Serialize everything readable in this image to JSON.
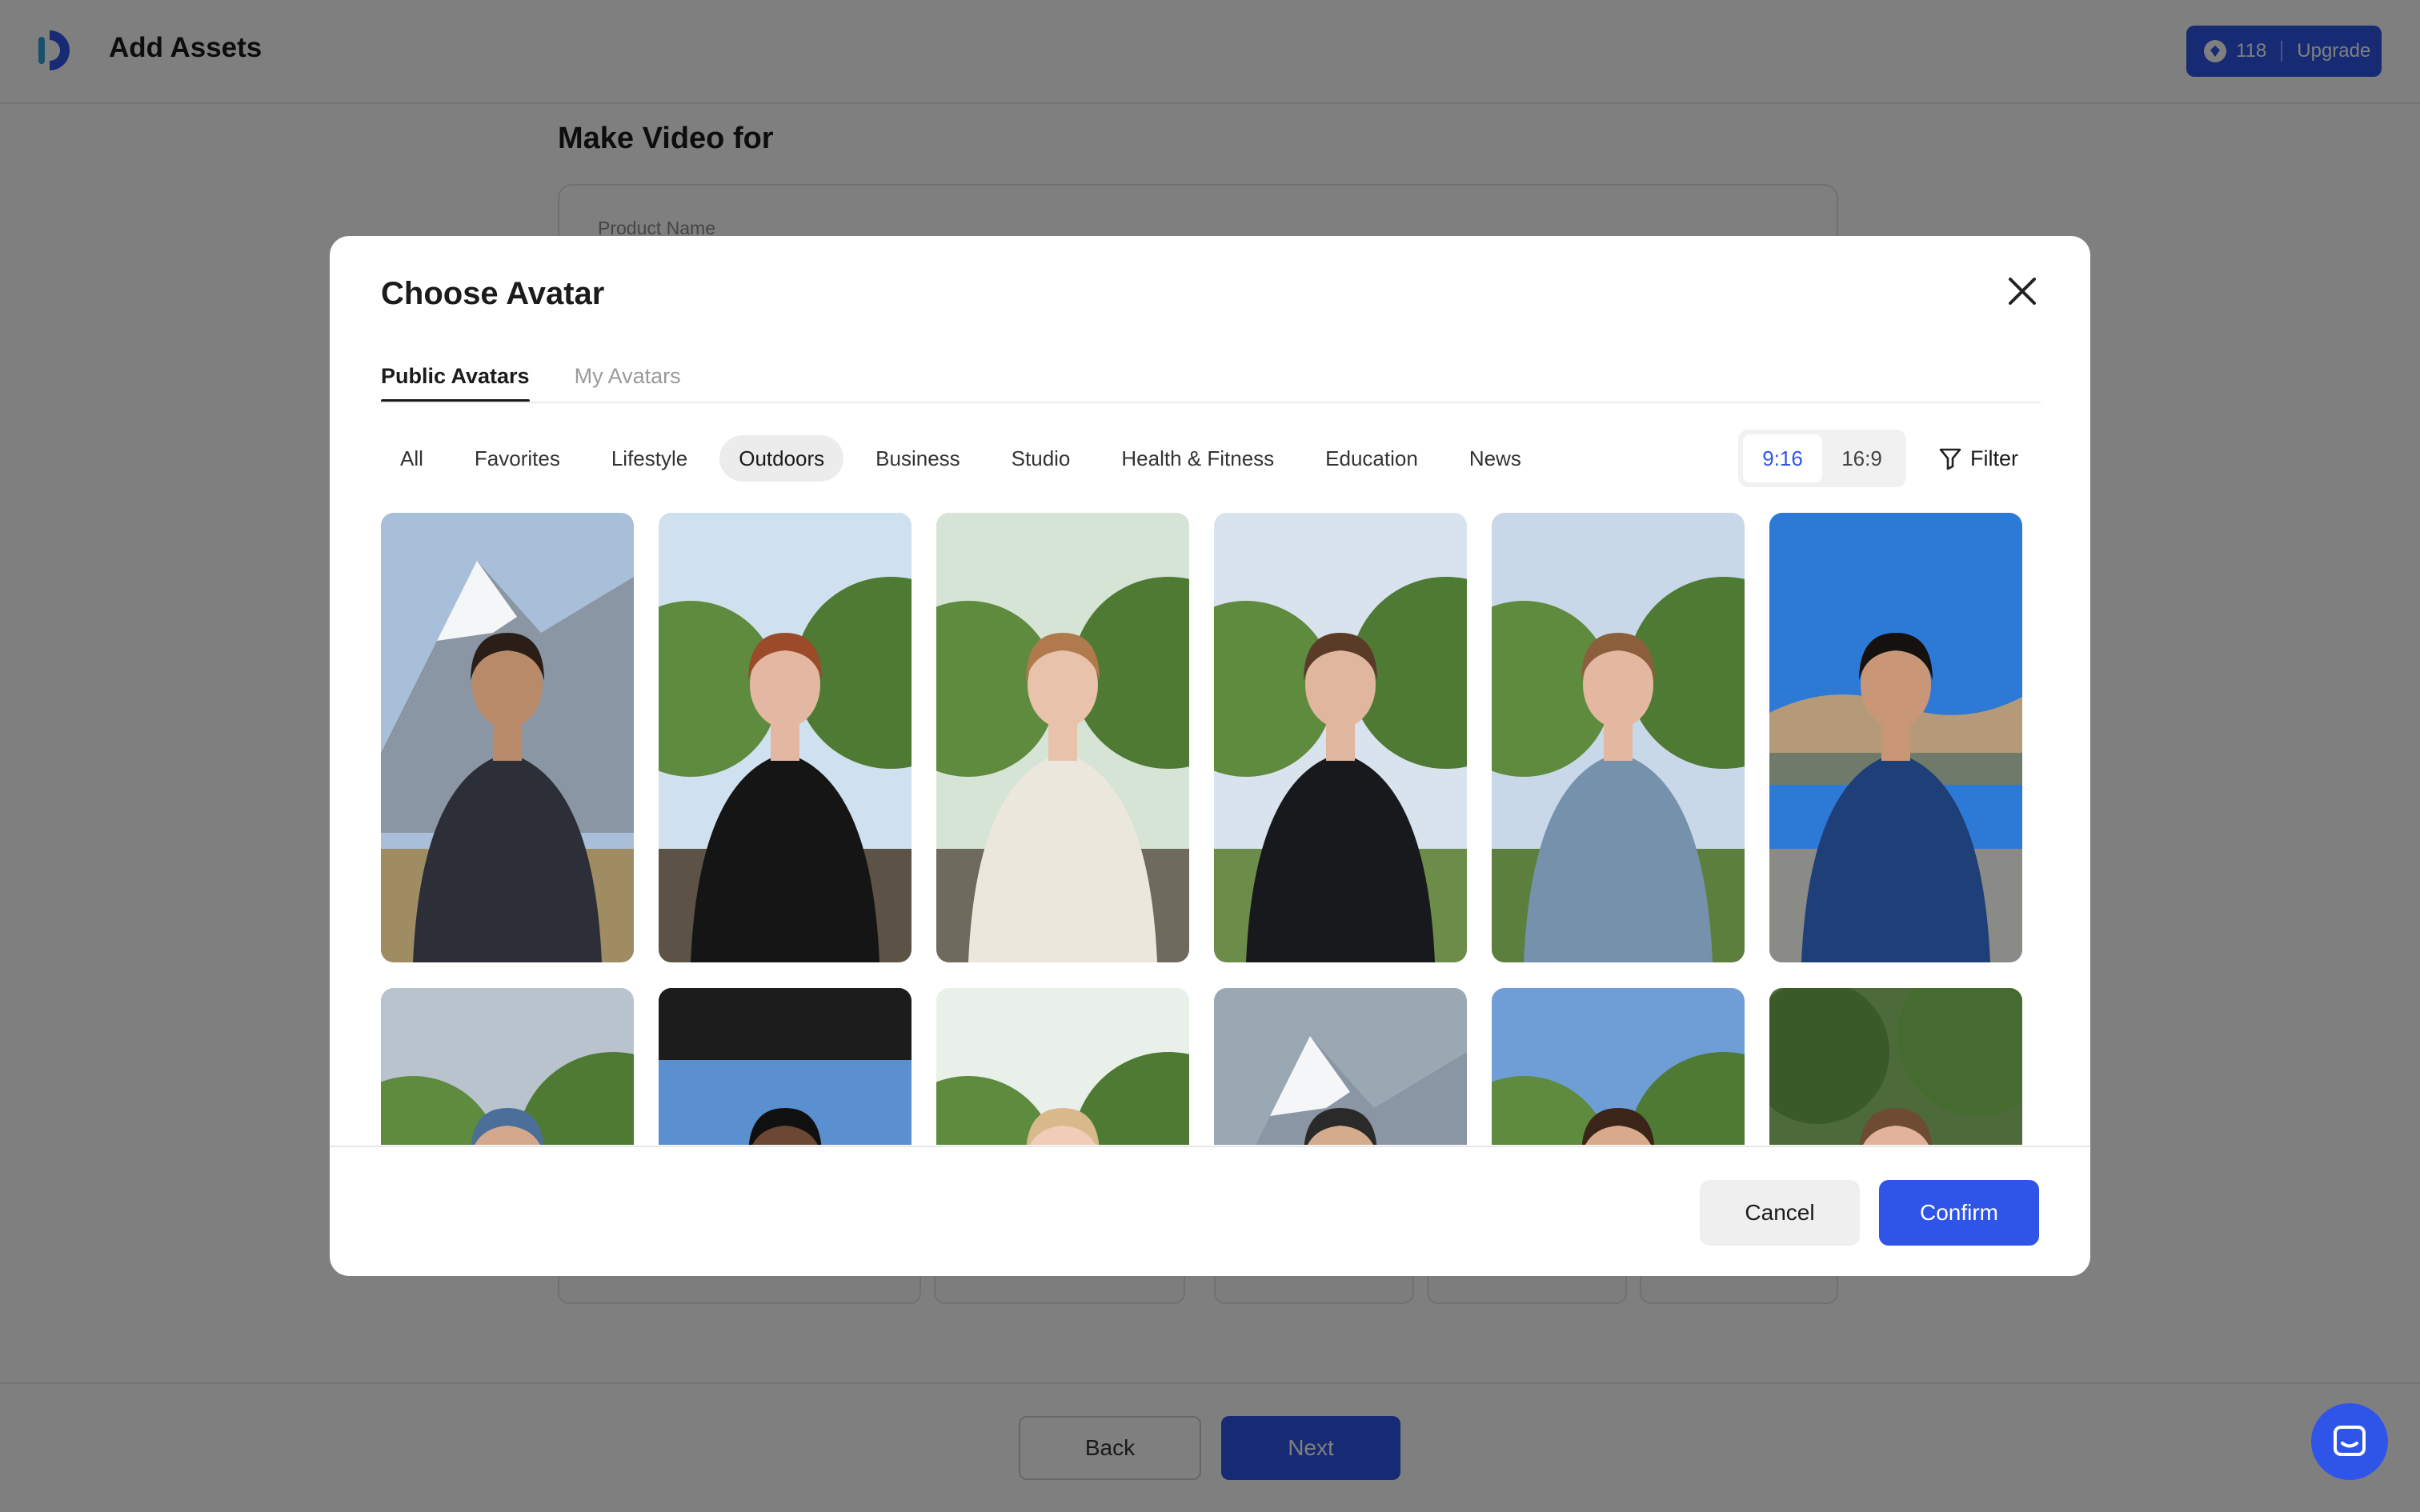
{
  "app": {
    "title": "Add Assets",
    "credits": "118",
    "upgrade_label": "Upgrade"
  },
  "background": {
    "heading": "Make Video for",
    "product_field_label": "Product Name",
    "back_label": "Back",
    "next_label": "Next"
  },
  "modal": {
    "title": "Choose Avatar",
    "tabs": [
      {
        "label": "Public Avatars",
        "active": true
      },
      {
        "label": "My Avatars",
        "active": false
      }
    ],
    "categories": [
      {
        "label": "All"
      },
      {
        "label": "Favorites"
      },
      {
        "label": "Lifestyle"
      },
      {
        "label": "Outdoors",
        "active": true
      },
      {
        "label": "Business"
      },
      {
        "label": "Studio"
      },
      {
        "label": "Health & Fitness"
      },
      {
        "label": "Education"
      },
      {
        "label": "News"
      }
    ],
    "ratio_options": [
      {
        "label": "9:16",
        "active": true
      },
      {
        "label": "16:9",
        "active": false
      }
    ],
    "filter_label": "Filter",
    "cancel_label": "Cancel",
    "confirm_label": "Confirm"
  },
  "avatars": [
    {
      "id": "a1",
      "sky": "#a9bfd9",
      "ground": "#a08c62",
      "top": "#2c2f38",
      "hair": "#2a1e16",
      "skin": "#b98a6a",
      "scene": "mountain"
    },
    {
      "id": "a2",
      "sky": "#cfe1ef",
      "ground": "#5c5246",
      "top": "#151515",
      "hair": "#9b4a2a",
      "skin": "#e3b7a1",
      "scene": "palm"
    },
    {
      "id": "a3",
      "sky": "#d6e4d5",
      "ground": "#6f6a5e",
      "top": "#ece7dd",
      "hair": "#b07a4c",
      "skin": "#e8c2ab",
      "scene": "garden"
    },
    {
      "id": "a4",
      "sky": "#d8e3ee",
      "ground": "#6c8d4a",
      "top": "#18191c",
      "hair": "#5a3b28",
      "skin": "#e0b79e",
      "scene": "park"
    },
    {
      "id": "a5",
      "sky": "#c9d8e8",
      "ground": "#5d7f3d",
      "top": "#7591ab",
      "hair": "#8b5e3c",
      "skin": "#e4b8a0",
      "scene": "trees"
    },
    {
      "id": "a6",
      "sky": "#2d79d6",
      "ground": "#8a8a86",
      "top": "#1f3f78",
      "hair": "#15110f",
      "skin": "#c99777",
      "scene": "lot"
    },
    {
      "id": "a7",
      "sky": "#b9c3cd",
      "ground": "#7c7f78",
      "top": "#5b6a80",
      "hair": "#4b6f98",
      "skin": "#d3a88c",
      "scene": "cloud"
    },
    {
      "id": "a8",
      "sky": "#5a8fd0",
      "ground": "#2a2a2a",
      "top": "#262626",
      "hair": "#101010",
      "skin": "#6b4734",
      "scene": "car"
    },
    {
      "id": "a9",
      "sky": "#e9f0ea",
      "ground": "#4f6b3a",
      "top": "#e6cfc0",
      "hair": "#d8b98c",
      "skin": "#efcdb9",
      "scene": "flowers"
    },
    {
      "id": "a10",
      "sky": "#9aa8b4",
      "ground": "#6a6f6a",
      "top": "#3b3b3b",
      "hair": "#2a2a2a",
      "skin": "#d5ab8e",
      "scene": "alps"
    },
    {
      "id": "a11",
      "sky": "#6f9ed6",
      "ground": "#5f7d49",
      "top": "#2a4a78",
      "hair": "#3a2518",
      "skin": "#d9a98b",
      "scene": "sky"
    },
    {
      "id": "a12",
      "sky": "#4d6b3a",
      "ground": "#3f5a2d",
      "top": "#6f5a4a",
      "hair": "#6e4b33",
      "skin": "#e0b39a",
      "scene": "forest"
    }
  ]
}
